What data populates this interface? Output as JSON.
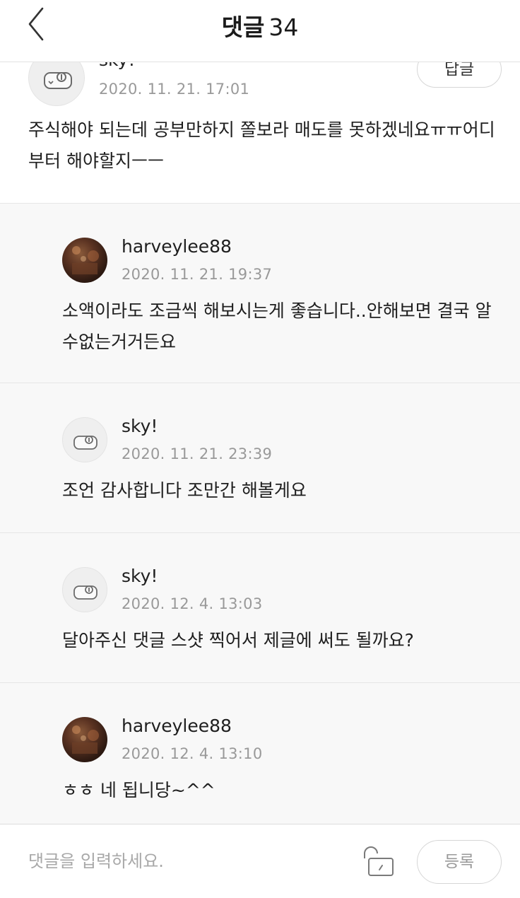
{
  "header": {
    "title": "댓글",
    "count": "34"
  },
  "comments": [
    {
      "username": "sky!",
      "date": "2020. 11. 21. 17:01",
      "text": "주식해야 되는데 공부만하지 쫄보라 매도를 못하겠네요ㅠㅠ어디부터 해야할지ㅡㅡ",
      "reply_label": "답글",
      "avatar": "default-avatar"
    },
    {
      "username": "harveylee88",
      "date": "2020. 11. 21. 19:37",
      "text": "소액이라도 조금씩 해보시는게 좋습니다..안해보면 결국 알수없는거거든요",
      "avatar": "photo-avatar"
    },
    {
      "username": "sky!",
      "date": "2020. 11. 21. 23:39",
      "text": "조언 감사합니다 조만간 해볼게요",
      "avatar": "default-avatar"
    },
    {
      "username": "sky!",
      "date": "2020. 12. 4. 13:03",
      "text": "달아주신 댓글 스샷 찍어서 제글에 써도 될까요?",
      "avatar": "default-avatar"
    },
    {
      "username": "harveylee88",
      "date": "2020. 12. 4. 13:10",
      "text": "ㅎㅎ 네 됩니당~^^",
      "avatar": "photo-avatar"
    }
  ],
  "footer": {
    "placeholder": "댓글을 입력하세요.",
    "submit_label": "등록",
    "lock_icon": "unlock-icon"
  }
}
